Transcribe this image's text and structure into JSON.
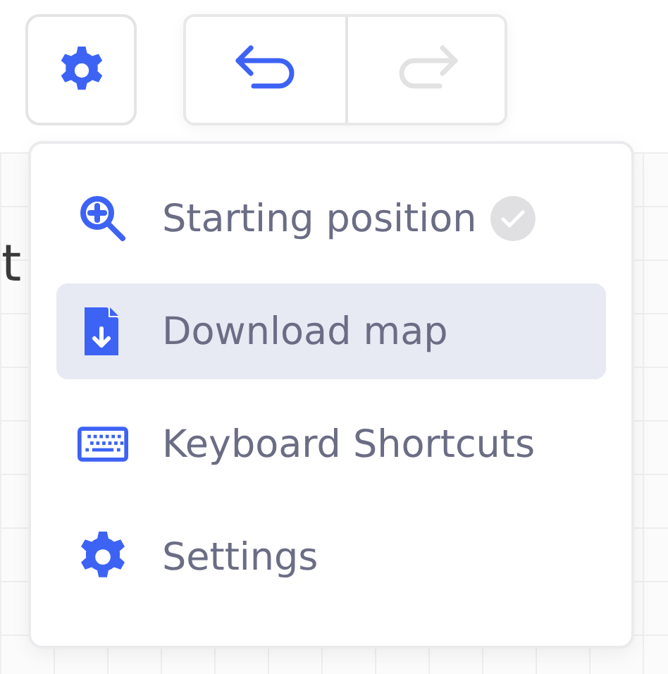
{
  "toolbar": {
    "history": [
      {
        "kind": "undo",
        "disabled": false
      },
      {
        "kind": "redo",
        "disabled": true
      }
    ]
  },
  "canvas": {
    "text": "t"
  },
  "menu": {
    "items": [
      {
        "kind": "zoom",
        "label": "Starting position",
        "selected": false,
        "checked": true
      },
      {
        "kind": "download",
        "label": "Download map",
        "selected": true,
        "checked": false
      },
      {
        "kind": "keyboard",
        "label": "Keyboard Shortcuts",
        "selected": false,
        "checked": false
      },
      {
        "kind": "settings",
        "label": "Settings",
        "selected": false,
        "checked": false
      }
    ]
  }
}
